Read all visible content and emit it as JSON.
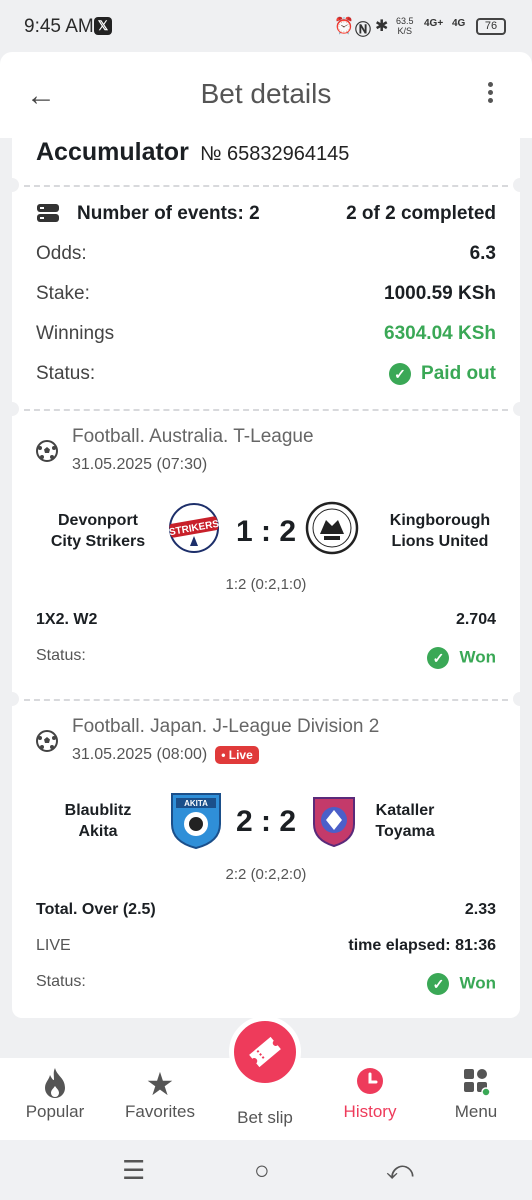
{
  "status_bar": {
    "time": "9:45 AM",
    "x_badge": "𝕏",
    "speed_value": "63.5",
    "speed_unit": "K/S",
    "net1": "4G+",
    "net2": "4G",
    "battery": "76"
  },
  "header": {
    "title": "Bet details"
  },
  "ticket": {
    "type": "Accumulator",
    "number": "№ 65832964145"
  },
  "summary": {
    "events_label": "Number of events: 2",
    "completed": "2 of 2 completed",
    "odds_label": "Odds:",
    "odds": "6.3",
    "stake_label": "Stake:",
    "stake": "1000.59 KSh",
    "winnings_label": "Winnings",
    "winnings": "6304.04 KSh",
    "status_label": "Status:",
    "status": "Paid out"
  },
  "events": [
    {
      "league": "Football. Australia. T-League",
      "date": "31.05.2025 (07:30)",
      "home_line1": "Devonport",
      "home_line2": "City Strikers",
      "away_line1": "Kingborough",
      "away_line2": "Lions United",
      "score": "1 : 2",
      "halves": "1:2 (0:2,1:0)",
      "market": "1X2. W2",
      "odds": "2.704",
      "status_label": "Status:",
      "status": "Won",
      "home_logo_text": "STRIKERS"
    },
    {
      "league": "Football. Japan. J-League Division 2",
      "date": "31.05.2025 (08:00)",
      "live": "• Live",
      "home_line1": "Blaublitz",
      "home_line2": "Akita",
      "away_line1": "Kataller",
      "away_line2": "Toyama",
      "score": "2 : 2",
      "halves": "2:2 (0:2,2:0)",
      "market": "Total. Over (2.5)",
      "odds": "2.33",
      "live_label": "LIVE",
      "elapsed": "time elapsed: 81:36",
      "status_label": "Status:",
      "status": "Won",
      "home_logo_text": "AKITA"
    }
  ],
  "nav": {
    "popular": "Popular",
    "favorites": "Favorites",
    "betslip": "Bet slip",
    "history": "History",
    "menu": "Menu"
  },
  "colors": {
    "accent": "#ee3b5b",
    "success": "#3aa856",
    "live": "#e03a3a"
  }
}
